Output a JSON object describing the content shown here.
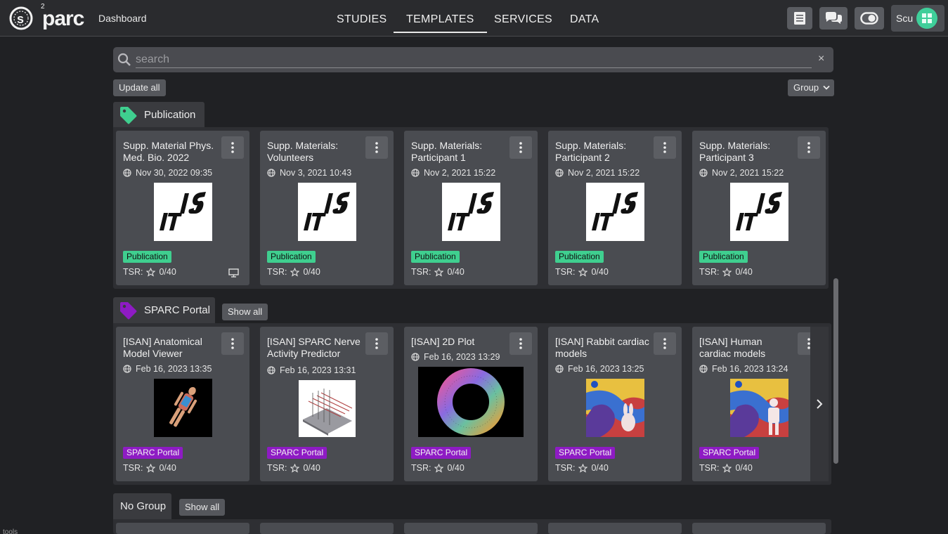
{
  "header": {
    "logo_text": "parc",
    "logo_super": "2",
    "dashboard": "Dashboard",
    "tabs": [
      {
        "label": "STUDIES"
      },
      {
        "label": "TEMPLATES",
        "active": true
      },
      {
        "label": "SERVICES"
      },
      {
        "label": "DATA"
      }
    ],
    "user_name": "Scu",
    "icons": [
      "manual-icon",
      "chat-icon",
      "theme-toggle-icon"
    ]
  },
  "search": {
    "placeholder": "search",
    "value": "",
    "clear": "×"
  },
  "toolbar": {
    "update_all": "Update all",
    "group": "Group"
  },
  "groups": [
    {
      "name": "Publication",
      "tag_color": "#3fcf8f",
      "show_all": "",
      "cards": [
        {
          "title": "Supp. Material Phys. Med. Bio. 2022",
          "date": "Nov 30, 2022 09:35",
          "tag": "Publication",
          "tsr": "TSR:",
          "score": "0/40"
        },
        {
          "title": "Supp. Materials: Volunteers",
          "date": "Nov 3, 2021 10:43",
          "tag": "Publication",
          "tsr": "TSR:",
          "score": "0/40"
        },
        {
          "title": "Supp. Materials: Participant 1",
          "date": "Nov 2, 2021 15:22",
          "tag": "Publication",
          "tsr": "TSR:",
          "score": "0/40"
        },
        {
          "title": "Supp. Materials: Participant 2",
          "date": "Nov 2, 2021 15:22",
          "tag": "Publication",
          "tsr": "TSR:",
          "score": "0/40"
        },
        {
          "title": "Supp. Materials: Participant 3",
          "date": "Nov 2, 2021 15:22",
          "tag": "Publication",
          "tsr": "TSR:",
          "score": "0/40"
        }
      ]
    },
    {
      "name": "SPARC Portal",
      "tag_color": "#8e1bc4",
      "show_all": "Show all",
      "cards": [
        {
          "title": "[ISAN] Anatomical Model Viewer",
          "date": "Feb 16, 2023 13:35",
          "tag": "SPARC Portal",
          "tsr": "TSR:",
          "score": "0/40"
        },
        {
          "title": "[ISAN] SPARC Nerve Activity Predictor",
          "date": "Feb 16, 2023 13:31",
          "tag": "SPARC Portal",
          "tsr": "TSR:",
          "score": "0/40"
        },
        {
          "title": "[ISAN] 2D Plot",
          "date": "Feb 16, 2023 13:29",
          "tag": "SPARC Portal",
          "tsr": "TSR:",
          "score": "0/40"
        },
        {
          "title": "[ISAN] Rabbit cardiac models",
          "date": "Feb 16, 2023 13:25",
          "tag": "SPARC Portal",
          "tsr": "TSR:",
          "score": "0/40"
        },
        {
          "title": "[ISAN] Human cardiac models",
          "date": "Feb 16, 2023 13:24",
          "tag": "SPARC Portal",
          "tsr": "TSR:",
          "score": "0/40"
        }
      ]
    },
    {
      "name": "No Group",
      "show_all": "Show all"
    }
  ],
  "footer": {
    "label": "tools"
  }
}
